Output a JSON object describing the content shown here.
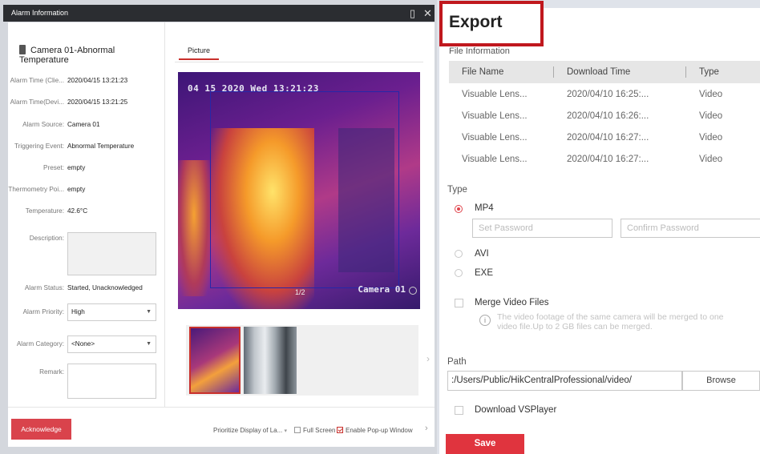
{
  "alarm": {
    "window_title": "Alarm Information",
    "camera_title": "Camera 01-Abnormal Temperature",
    "fields": [
      {
        "label": "Alarm Time (Clie...",
        "value": "2020/04/15 13:21:23"
      },
      {
        "label": "Alarm Time(Devi...",
        "value": "2020/04/15 13:21:25"
      },
      {
        "label": "Alarm Source:",
        "value": "Camera 01"
      },
      {
        "label": "Triggering Event:",
        "value": "Abnormal Temperature"
      },
      {
        "label": "Preset:",
        "value": "empty"
      },
      {
        "label": "Thermometry Poi...",
        "value": "empty"
      },
      {
        "label": "Temperature:",
        "value": "42.6°C"
      }
    ],
    "description_label": "Description:",
    "status_label": "Alarm Status:",
    "status_value": "Started, Unacknowledged",
    "priority_label": "Alarm Priority:",
    "priority_value": "High",
    "category_label": "Alarm Category:",
    "category_value": "<None>",
    "remark_label": "Remark:",
    "picture_tab": "Picture",
    "overlay_timestamp": "04 15 2020 Wed 13:21:23",
    "overlay_camera": "Camera 01",
    "page_indicator": "1/2",
    "acknowledge_label": "Acknowledge",
    "prioritize_label": "Prioritize Display of La...",
    "fullscreen_label": "Full Screen",
    "enable_popup_label": "Enable Pop-up Window"
  },
  "export": {
    "title": "Export",
    "file_info_label": "File Information",
    "columns": [
      "File Name",
      "Download Time",
      "Type"
    ],
    "rows": [
      [
        "Visuable Lens...",
        "2020/04/10 16:25:...",
        "Video"
      ],
      [
        "Visuable Lens...",
        "2020/04/10 16:26:...",
        "Video"
      ],
      [
        "Visuable Lens...",
        "2020/04/10 16:27:...",
        "Video"
      ],
      [
        "Visuable Lens...",
        "2020/04/10 16:27:...",
        "Video"
      ]
    ],
    "type_label": "Type",
    "type_options": [
      "MP4",
      "AVI",
      "EXE"
    ],
    "selected_type": "MP4",
    "set_password_placeholder": "Set Password",
    "confirm_password_placeholder": "Confirm Password",
    "merge_label": "Merge Video Files",
    "merge_info": "The video footage of the same camera will be merged to one video file.Up to 2 GB files can be merged.",
    "path_label": "Path",
    "path_value": ":/Users/Public/HikCentralProfessional/video/",
    "browse_label": "Browse",
    "download_player_label": "Download VSPlayer",
    "save_label": "Save",
    "accent_color": "#e0343e"
  }
}
